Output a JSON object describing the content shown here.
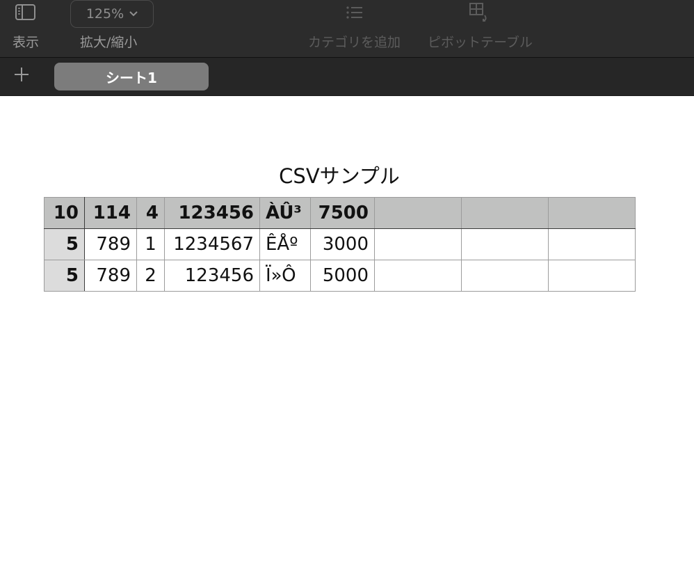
{
  "toolbar": {
    "view_label": "表示",
    "zoom_value": "125%",
    "zoom_label": "拡大/縮小",
    "add_category_label": "カテゴリを追加",
    "pivot_label": "ピボットテーブル"
  },
  "tabs": {
    "add_label": "+",
    "sheet1": "シート1"
  },
  "table": {
    "title": "CSVサンプル",
    "header": [
      "10",
      "114",
      "4",
      "123456",
      "ÀÛ³",
      "7500",
      "",
      "",
      ""
    ],
    "rows": [
      [
        "5",
        "789",
        "1",
        "1234567",
        "ÊÅº",
        "3000",
        "",
        "",
        ""
      ],
      [
        "5",
        "789",
        "2",
        "123456",
        "Ï»Ô",
        "5000",
        "",
        "",
        ""
      ]
    ]
  },
  "colors": {
    "toolbar_bg": "#2c2c2c",
    "tab_bg": "#262626",
    "active_tab": "#7c7c7c",
    "header_fill": "#c0c1c0",
    "rowhead_fill": "#dcdcdc"
  }
}
